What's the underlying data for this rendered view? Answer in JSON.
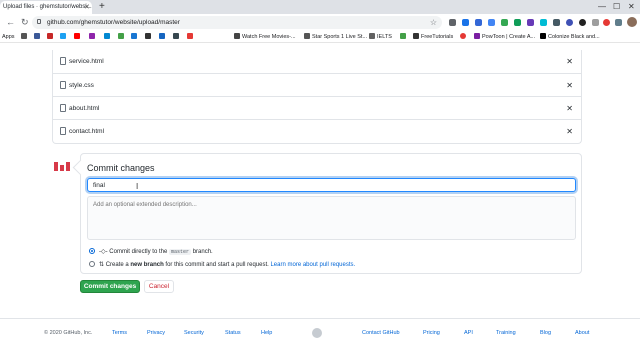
{
  "tab": {
    "title": "Upload files · ghemstutor/websi..."
  },
  "omnibox": {
    "url": "github.com/ghemstutor/website/upload/master"
  },
  "bookmarks": [
    "Apps",
    "Watch Free Movies-...",
    "Star Sports 1 Live St...",
    "IELTS",
    "FreeTutorials",
    "PowToon | Create A...",
    "Colonize Black and..."
  ],
  "files": [
    "service.html",
    "style.css",
    "about.html",
    "contact.html"
  ],
  "remove_glyph": "✕",
  "commit": {
    "title": "Commit changes",
    "summary_value": "final",
    "desc_placeholder": "Add an optional extended description...",
    "option1_pre": "Commit directly to the",
    "option1_branch": "master",
    "option1_post": "branch.",
    "option2_pre": "Create a",
    "option2_bold": "new branch",
    "option2_post": "for this commit and start a pull request.",
    "option2_link": "Learn more about pull requests."
  },
  "buttons": {
    "commit": "Commit changes",
    "cancel": "Cancel"
  },
  "footer": {
    "copyright": "© 2020 GitHub, Inc.",
    "links_left": [
      "Terms",
      "Privacy",
      "Security",
      "Status",
      "Help"
    ],
    "links_right": [
      "Contact GitHub",
      "Pricing",
      "API",
      "Training",
      "Blog",
      "About"
    ]
  },
  "colors": {
    "primary_button": "#2ea44f",
    "link": "#0366d6",
    "cancel": "#cb2431"
  }
}
